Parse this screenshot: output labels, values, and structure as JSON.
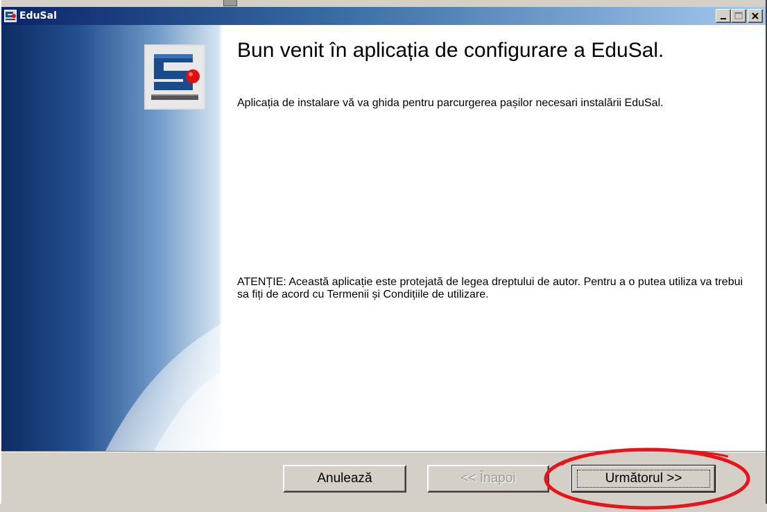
{
  "window": {
    "title": "EduSal"
  },
  "caption_buttons": {
    "minimize": "minimize-icon",
    "maximize": "maximize-icon",
    "close": "close-icon"
  },
  "wizard": {
    "heading": "Bun venit în aplicația de configurare a EduSal.",
    "intro": "Aplicația de instalare vă va ghida pentru parcurgerea pașilor necesari instalării EduSal.",
    "warning": "ATENȚIE: Această aplicație este protejată de legea dreptului de autor. Pentru a o putea utiliza va trebui sa fiți de acord cu Termenii și Condițiile de utilizare."
  },
  "buttons": {
    "cancel_label": "Anulează",
    "back_label": "<< Înapoi",
    "next_label": "Următorul >>"
  },
  "colors": {
    "titlebar_start": "#0a246a",
    "titlebar_end": "#a6caf0",
    "annotation": "#e8141c",
    "logo_red": "#e01010"
  }
}
